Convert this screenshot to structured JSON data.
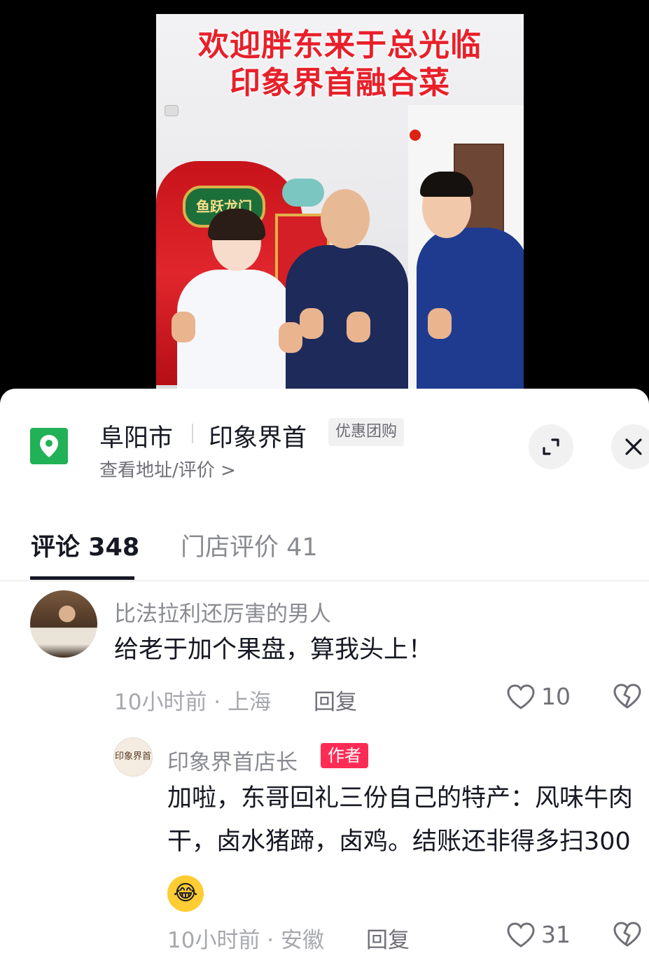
{
  "video": {
    "caption_line1": "欢迎胖东来于总光临",
    "caption_line2": "印象界首融合菜",
    "sign_text": "鱼跃龙门"
  },
  "poi": {
    "city": "阜阳市",
    "name": "印象界首",
    "badge": "优惠团购",
    "sub_link": "查看地址/评价 >",
    "icon": "location-pin-icon",
    "accent_color": "#21b156"
  },
  "tabs": [
    {
      "label": "评论 348",
      "active": true
    },
    {
      "label": "门店评价 41",
      "active": false
    }
  ],
  "comments": [
    {
      "user": "比法拉利还厉害的男人",
      "text": "给老于加个果盘，算我头上！",
      "meta": "10小时前 · 上海",
      "reply_label": "回复",
      "likes": "10"
    },
    {
      "user": "印象界首店长",
      "author_badge": "作者",
      "avatar_text": "印象界首",
      "text": "加啦，东哥回礼三份自己的特产：风味牛肉干，卤水猪蹄，卤鸡。结账还非得多扫300",
      "meta": "10小时前 · 安徽",
      "reply_label": "回复",
      "likes": "31"
    }
  ],
  "colors": {
    "author_badge": "#fe2c55",
    "caption": "#e8202a"
  }
}
